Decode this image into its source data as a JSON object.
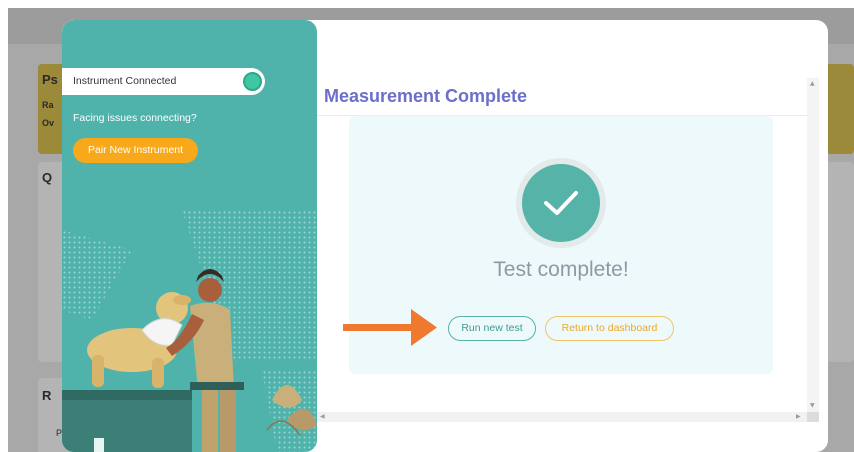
{
  "background": {
    "card_letters": [
      "Ps",
      "Ra",
      "Ov",
      "Q",
      "R",
      "P"
    ]
  },
  "sidebar": {
    "status_label": "Instrument Connected",
    "status_color": "#3fc6a4",
    "issue_text": "Facing issues connecting?",
    "pair_button_label": "Pair New Instrument",
    "accent_color": "#f7a91b",
    "panel_color": "#4fb3ac"
  },
  "main": {
    "title": "Measurement Complete",
    "status_icon": "checkmark-icon",
    "status_message": "Test complete!",
    "run_button_label": "Run new test",
    "return_button_label": "Return to dashboard"
  },
  "scrollbar": {
    "up_glyph": "▲",
    "down_glyph": "▼",
    "left_glyph": "◀",
    "right_glyph": "▶"
  },
  "annotation": {
    "arrow_icon": "arrow-right-icon",
    "color": "#ef7a2f"
  }
}
